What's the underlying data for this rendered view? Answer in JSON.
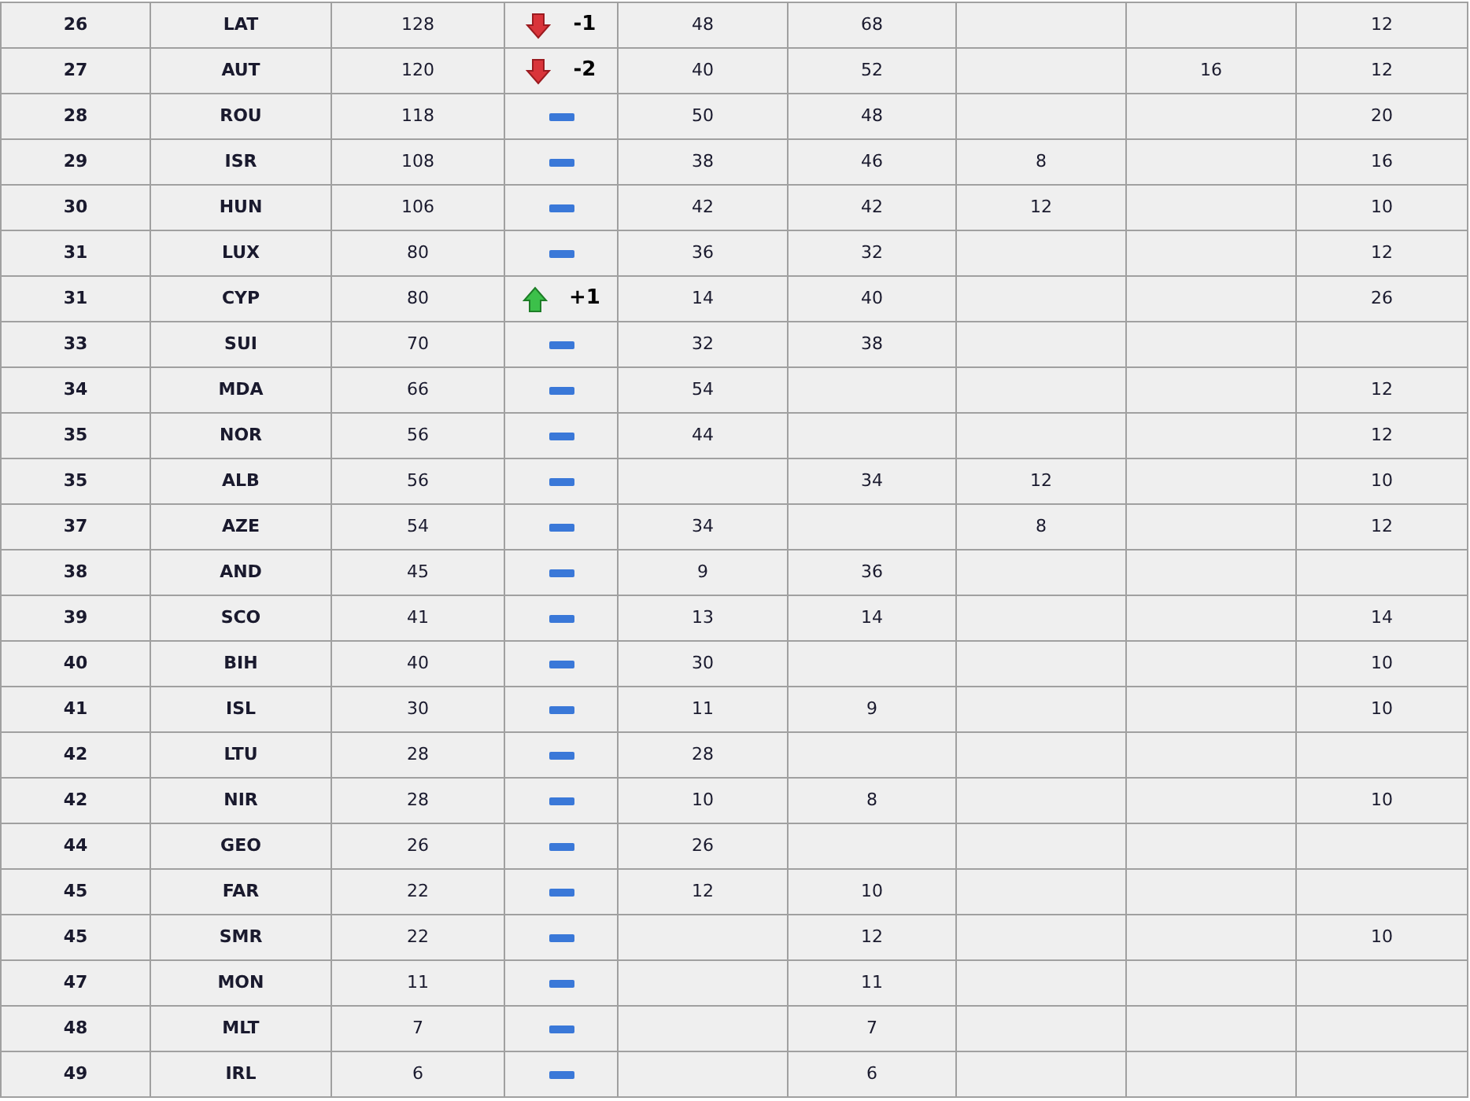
{
  "rows": [
    {
      "rank": "26",
      "team": "LAT",
      "points": "128",
      "trend": {
        "kind": "down",
        "change": "-1"
      },
      "col_5": "48",
      "col_6": "68",
      "col_9": "12"
    },
    {
      "rank": "27",
      "team": "AUT",
      "points": "120",
      "trend": {
        "kind": "down",
        "change": "-2"
      },
      "col_5": "40",
      "col_6": "52",
      "col_8": "16",
      "col_9": "12"
    },
    {
      "rank": "28",
      "team": "ROU",
      "points": "118",
      "trend": {
        "kind": "same"
      },
      "col_5": "50",
      "col_6": "48",
      "col_9": "20"
    },
    {
      "rank": "29",
      "team": "ISR",
      "points": "108",
      "trend": {
        "kind": "same"
      },
      "col_5": "38",
      "col_6": "46",
      "col_7": "8",
      "col_9": "16"
    },
    {
      "rank": "30",
      "team": "HUN",
      "points": "106",
      "trend": {
        "kind": "same"
      },
      "col_5": "42",
      "col_6": "42",
      "col_7": "12",
      "col_9": "10"
    },
    {
      "rank": "31",
      "team": "LUX",
      "points": "80",
      "trend": {
        "kind": "same"
      },
      "col_5": "36",
      "col_6": "32",
      "col_9": "12"
    },
    {
      "rank": "31",
      "team": "CYP",
      "points": "80",
      "trend": {
        "kind": "up",
        "change": "+1"
      },
      "col_5": "14",
      "col_6": "40",
      "col_9": "26"
    },
    {
      "rank": "33",
      "team": "SUI",
      "points": "70",
      "trend": {
        "kind": "same"
      },
      "col_5": "32",
      "col_6": "38"
    },
    {
      "rank": "34",
      "team": "MDA",
      "points": "66",
      "trend": {
        "kind": "same"
      },
      "col_5": "54",
      "col_9": "12"
    },
    {
      "rank": "35",
      "team": "NOR",
      "points": "56",
      "trend": {
        "kind": "same"
      },
      "col_5": "44",
      "col_9": "12"
    },
    {
      "rank": "35",
      "team": "ALB",
      "points": "56",
      "trend": {
        "kind": "same"
      },
      "col_6": "34",
      "col_7": "12",
      "col_9": "10"
    },
    {
      "rank": "37",
      "team": "AZE",
      "points": "54",
      "trend": {
        "kind": "same"
      },
      "col_5": "34",
      "col_7": "8",
      "col_9": "12"
    },
    {
      "rank": "38",
      "team": "AND",
      "points": "45",
      "trend": {
        "kind": "same"
      },
      "col_5": "9",
      "col_6": "36"
    },
    {
      "rank": "39",
      "team": "SCO",
      "points": "41",
      "trend": {
        "kind": "same"
      },
      "col_5": "13",
      "col_6": "14",
      "col_9": "14"
    },
    {
      "rank": "40",
      "team": "BIH",
      "points": "40",
      "trend": {
        "kind": "same"
      },
      "col_5": "30",
      "col_9": "10"
    },
    {
      "rank": "41",
      "team": "ISL",
      "points": "30",
      "trend": {
        "kind": "same"
      },
      "col_5": "11",
      "col_6": "9",
      "col_9": "10"
    },
    {
      "rank": "42",
      "team": "LTU",
      "points": "28",
      "trend": {
        "kind": "same"
      },
      "col_5": "28"
    },
    {
      "rank": "42",
      "team": "NIR",
      "points": "28",
      "trend": {
        "kind": "same"
      },
      "col_5": "10",
      "col_6": "8",
      "col_9": "10"
    },
    {
      "rank": "44",
      "team": "GEO",
      "points": "26",
      "trend": {
        "kind": "same"
      },
      "col_5": "26"
    },
    {
      "rank": "45",
      "team": "FAR",
      "points": "22",
      "trend": {
        "kind": "same"
      },
      "col_5": "12",
      "col_6": "10"
    },
    {
      "rank": "45",
      "team": "SMR",
      "points": "22",
      "trend": {
        "kind": "same"
      },
      "col_6": "12",
      "col_9": "10"
    },
    {
      "rank": "47",
      "team": "MON",
      "points": "11",
      "trend": {
        "kind": "same"
      },
      "col_6": "11"
    },
    {
      "rank": "48",
      "team": "MLT",
      "points": "7",
      "trend": {
        "kind": "same"
      },
      "col_6": "7"
    },
    {
      "rank": "49",
      "team": "IRL",
      "points": "6",
      "trend": {
        "kind": "same"
      },
      "col_6": "6"
    }
  ]
}
